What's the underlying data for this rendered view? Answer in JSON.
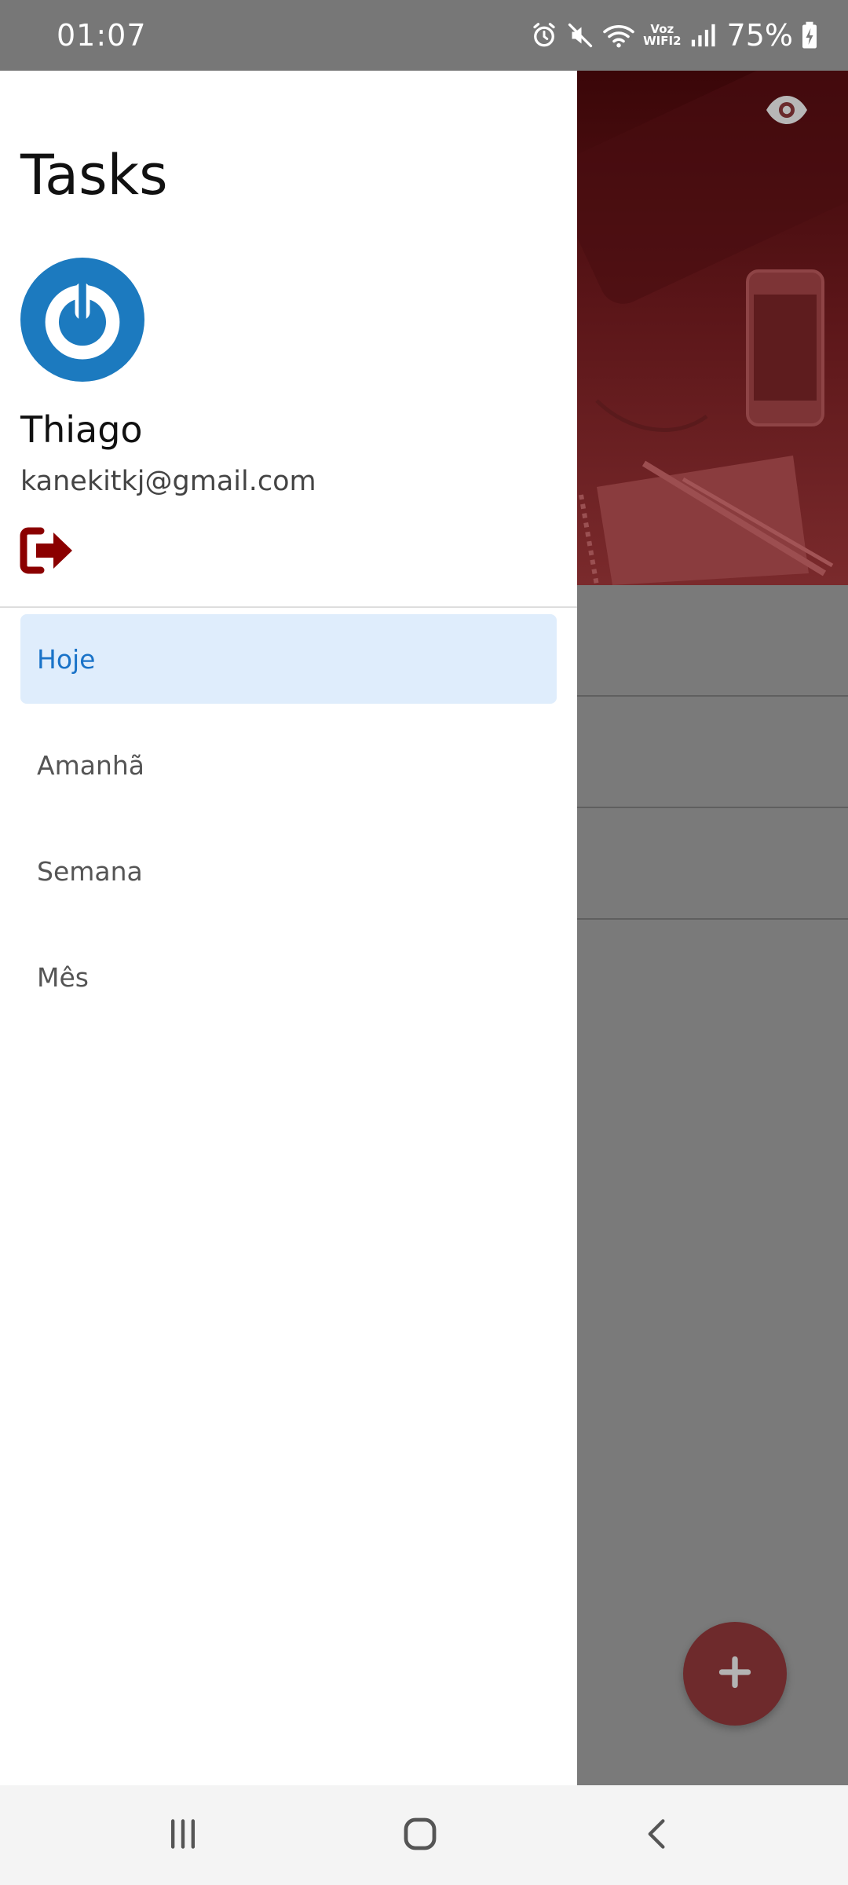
{
  "status_bar": {
    "time": "01:07",
    "voz_label": "Voz",
    "wifi_label": "WIFI2",
    "battery": "75%",
    "icons": [
      "alarm-icon",
      "mute-icon",
      "wifi-icon",
      "signal-icon",
      "battery-charging-icon"
    ]
  },
  "drawer": {
    "app_title": "Tasks",
    "user": {
      "name": "Thiago",
      "email": "kanekitkj@gmail.com",
      "avatar_icon": "power-logo-icon"
    },
    "logout_icon": "logout-icon",
    "menu": [
      {
        "label": "Hoje",
        "active": true
      },
      {
        "label": "Amanhã",
        "active": false
      },
      {
        "label": "Semana",
        "active": false
      },
      {
        "label": "Mês",
        "active": false
      }
    ]
  },
  "background_app": {
    "visibility_icon": "eye-icon",
    "fab_icon": "plus-icon"
  },
  "nav_bar": {
    "buttons": [
      "recent-apps-icon",
      "home-icon",
      "back-icon"
    ]
  },
  "colors": {
    "accent_blue": "#1a73c8",
    "active_item_bg": "#dfedfc",
    "brand_red": "#8b0000",
    "header_red": "#5a1518",
    "scrim_gray": "#7a7a7a"
  }
}
